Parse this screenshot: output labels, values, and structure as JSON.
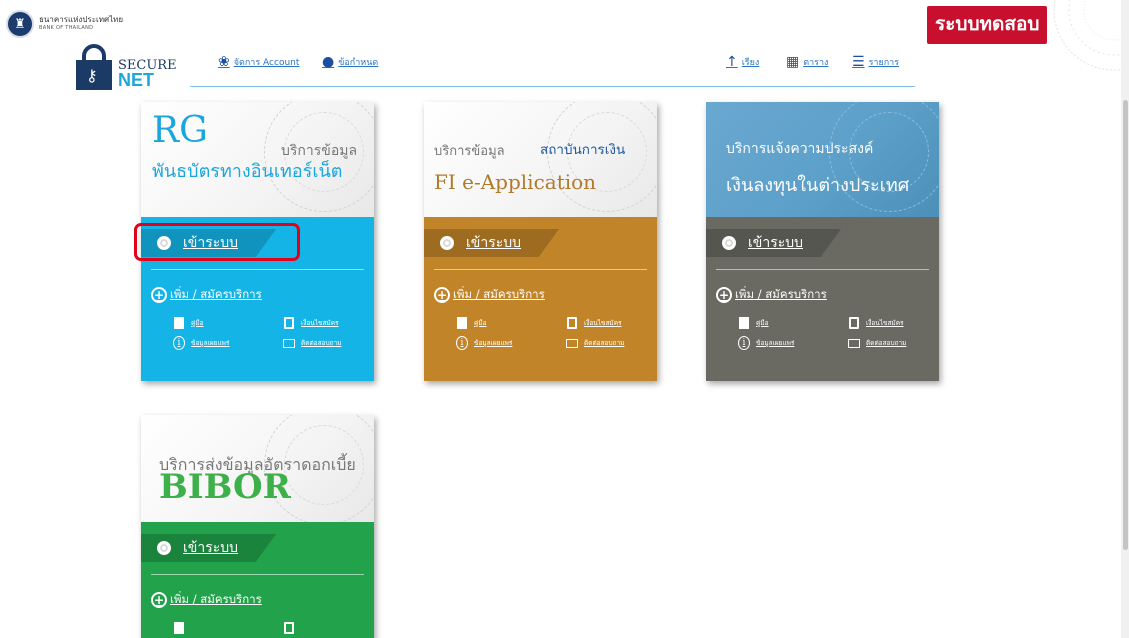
{
  "org": {
    "name_th": "ธนาคารแห่งประเทศไทย",
    "name_en": "BANK OF THAILAND"
  },
  "test_badge": "ระบบทดสอบ",
  "brand": {
    "secure": "SECURE",
    "net": "NET"
  },
  "nav": {
    "left": [
      {
        "icon": "manage-icon",
        "label": "จัดการ Account"
      },
      {
        "icon": "pin-icon",
        "label": "ข้อกำหนด"
      }
    ],
    "right": [
      {
        "icon": "arrow-up-icon",
        "label": "เรียง"
      },
      {
        "icon": "grid-icon",
        "label": "ตาราง"
      },
      {
        "icon": "list-icon",
        "label": "รายการ"
      }
    ]
  },
  "cards": [
    {
      "id": "rg",
      "title_big": "RG",
      "subtitle1": "บริการข้อมูล",
      "subtitle2": "พันธบัตรทางอินเทอร์เน็ต",
      "color": "#14b4e6",
      "login": "เข้าระบบ",
      "register": "เพิ่ม / สมัครบริการ",
      "links": [
        "คู่มือ",
        "เงื่อนไขสมัคร",
        "ข้อมูลเผยแพร่",
        "ติดต่อสอบถาม"
      ]
    },
    {
      "id": "fi",
      "subtitle1": "บริการข้อมูล",
      "subtitle2": "สถาบันการเงิน",
      "title_big": "FI e-Application",
      "color": "#c18428",
      "login": "เข้าระบบ",
      "register": "เพิ่ม / สมัครบริการ",
      "links": [
        "คู่มือ",
        "เงื่อนไขสมัคร",
        "ข้อมูลเผยแพร่",
        "ติดต่อสอบถาม"
      ]
    },
    {
      "id": "fx",
      "subtitle1": "บริการแจ้งความประสงค์",
      "subtitle2": "เงินลงทุนในต่างประเทศ",
      "color_top": "#5b9fc8",
      "color": "#6a6a62",
      "login": "เข้าระบบ",
      "register": "เพิ่ม / สมัครบริการ",
      "links": [
        "คู่มือ",
        "เงื่อนไขสมัคร",
        "ข้อมูลเผยแพร่",
        "ติดต่อสอบถาม"
      ]
    },
    {
      "id": "bibor",
      "subtitle1": "บริการส่งข้อมูลอัตราดอกเบี้ย",
      "title_big": "BIBOR",
      "color": "#22a24a",
      "login": "เข้าระบบ",
      "register": "เพิ่ม / สมัครบริการ"
    }
  ]
}
